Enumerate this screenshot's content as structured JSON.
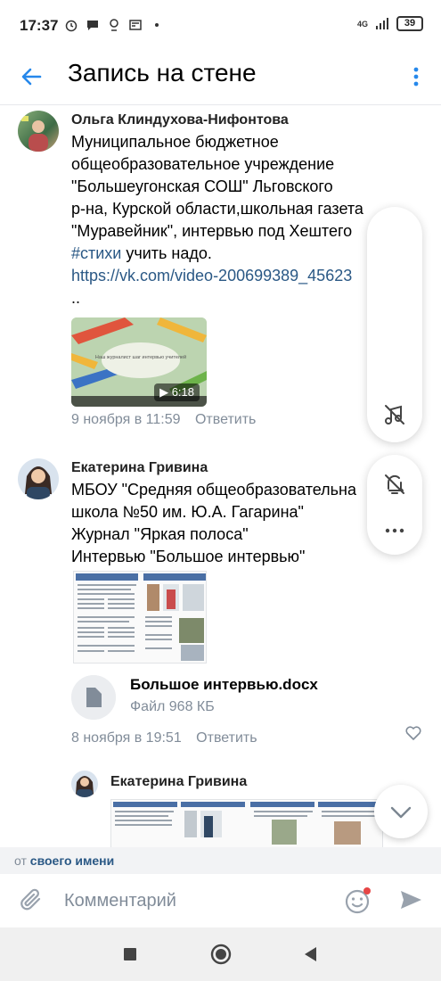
{
  "status_bar": {
    "time": "17:37",
    "network": "4G",
    "battery": "39",
    "icons": [
      "alarm-icon",
      "chat-icon",
      "location-icon",
      "news-icon",
      "dot-icon",
      "signal-icon",
      "battery-icon"
    ]
  },
  "header": {
    "title": "Запись на стене",
    "back_icon": "arrow-left-icon",
    "menu_icon": "more-vertical-icon"
  },
  "comments": [
    {
      "author": "Ольга Клиндухова-Нифонтова",
      "text_lines": [
        "Муниципальное бюджетное",
        "общеобразовательное учреждение",
        "\"Большеугонская СОШ\" Льговского",
        "р-на, Курской области,школьная газета",
        "\"Муравейник\", интервью под Хештего"
      ],
      "hashtag": "#стихи",
      "hashtag_suffix": " учить надо.",
      "link": "https://vk.com/video-200699389_45623",
      "ellipsis": "..",
      "video": {
        "title": "Наш журналист шаг интервью учителей",
        "duration": "6:18"
      },
      "date": "9 ноября в 11:59",
      "reply": "Ответить"
    },
    {
      "author": "Екатерина Гривина",
      "text_lines": [
        "МБОУ \"Средняя общеобразовательна",
        "школа №50 им. Ю.А. Гагарина\"",
        "Журнал \"Яркая полоса\"",
        "Интервью \"Большое интервью\""
      ],
      "document": {
        "name": "Большое интервью.docx",
        "size": "Файл 968 КБ"
      },
      "date": "8 ноября в 19:51",
      "reply": "Ответить"
    },
    {
      "author": "Екатерина Гривина"
    }
  ],
  "from_bar": {
    "prefix": "от",
    "name": "своего имени"
  },
  "composer": {
    "placeholder": "Комментарий"
  },
  "colors": {
    "link": "#2a5885",
    "accent": "#2688eb",
    "meta": "#818c99"
  }
}
